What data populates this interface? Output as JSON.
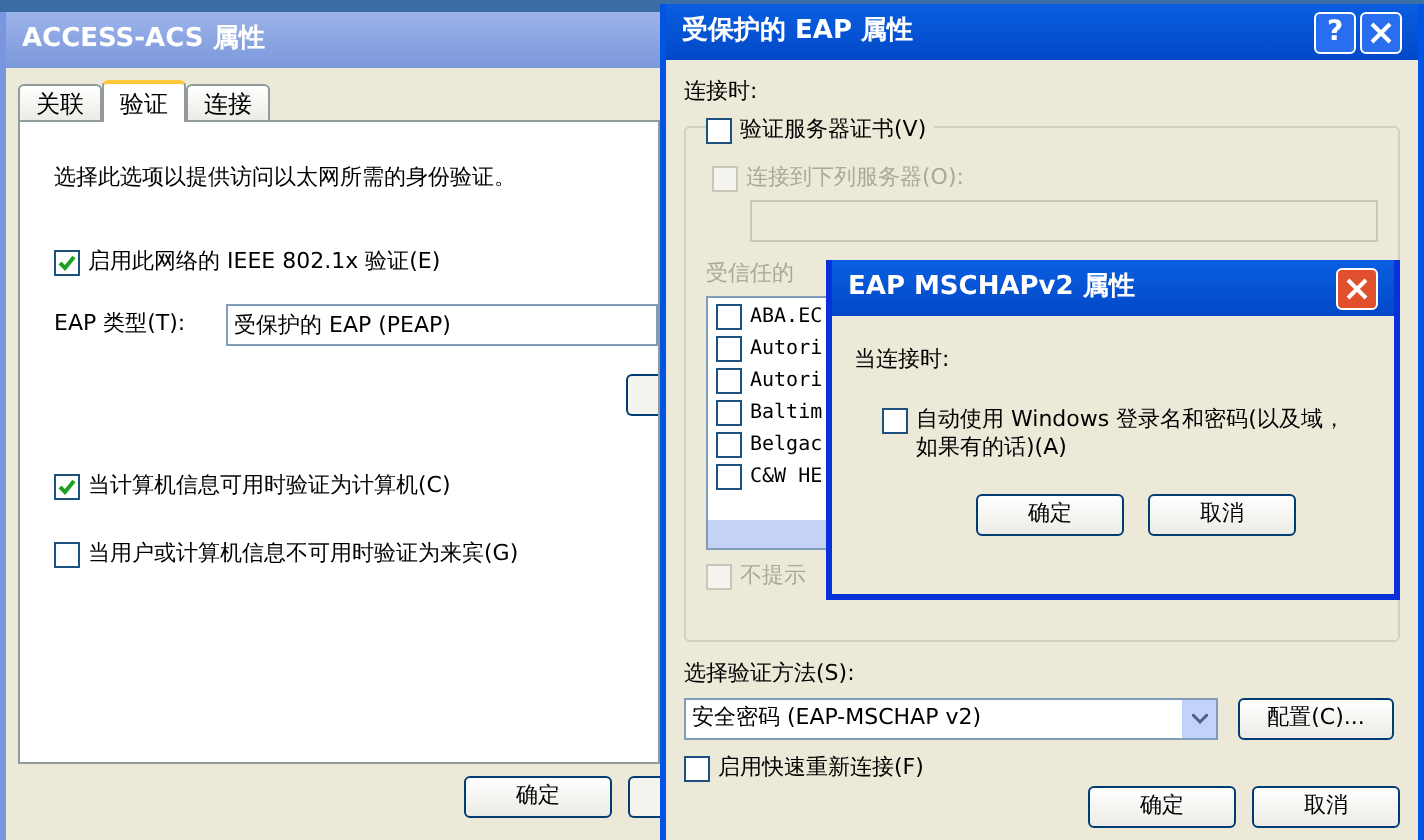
{
  "access_window": {
    "title": "ACCESS-ACS 属性",
    "tabs": [
      {
        "label": "关联",
        "selected": false
      },
      {
        "label": "验证",
        "selected": true
      },
      {
        "label": "连接",
        "selected": false
      }
    ],
    "description": "选择此选项以提供访问以太网所需的身份验证。",
    "enable_8021x": {
      "label": "启用此网络的 IEEE 802.1x 验证(E)",
      "checked": true
    },
    "eap_type": {
      "label": "EAP 类型(T):",
      "value": "受保护的 EAP (PEAP)"
    },
    "options": [
      {
        "label": "当计算机信息可用时验证为计算机(C)",
        "checked": true
      },
      {
        "label": "当用户或计算机信息不可用时验证为来宾(G)",
        "checked": false
      }
    ],
    "buttons": [
      "确定"
    ]
  },
  "peap_window": {
    "title": "受保护的 EAP 属性",
    "help_glyph": "?",
    "when_connecting": "连接时:",
    "validate_cert": {
      "label": "验证服务器证书(V)",
      "checked": false
    },
    "connect_servers": {
      "label": "连接到下列服务器(O):",
      "checked": false,
      "disabled": true
    },
    "trusted_label": "受信任的",
    "trusted_roots": [
      {
        "label": "ABA.EC",
        "checked": false
      },
      {
        "label": "Autori",
        "checked": false
      },
      {
        "label": "Autori",
        "checked": false
      },
      {
        "label": "Baltim",
        "checked": false
      },
      {
        "label": "Belgac",
        "checked": false
      },
      {
        "label": "C&W HE",
        "checked": false
      }
    ],
    "no_prompt": {
      "label": "不提示",
      "checked": false,
      "disabled": true
    },
    "method_label": "选择验证方法(S):",
    "method_value": "安全密码 (EAP-MSCHAP v2)",
    "configure_button": "配置(C)...",
    "fast_reconnect": {
      "label": "启用快速重新连接(F)",
      "checked": false
    },
    "buttons": [
      "确定",
      "取消"
    ]
  },
  "mschap_dialog": {
    "title": "EAP MSCHAPv2 属性",
    "when_connecting": "当连接时:",
    "auto_logon": {
      "label": "自动使用 Windows 登录名和密码(以及域，如果有的话)(A)",
      "checked": false
    },
    "buttons": [
      "确定",
      "取消"
    ]
  }
}
